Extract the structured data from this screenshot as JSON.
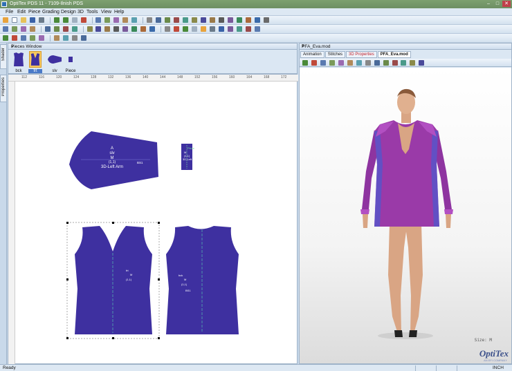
{
  "window": {
    "title": "OptiTex PDS 11 - 7109-Ilnish PDS",
    "min": "–",
    "max": "□",
    "close": "✕"
  },
  "menu": [
    "File",
    "Edit",
    "Piece",
    "Grading",
    "Design",
    "3D",
    "Tools",
    "View",
    "Help"
  ],
  "side_tabs": [
    "Shader",
    "Properties"
  ],
  "pieces_window": {
    "title": "Pieces Window",
    "pin": "↓",
    "close": "×",
    "pieces": [
      {
        "name": "bck",
        "selected": false
      },
      {
        "name": "frt",
        "selected": true
      },
      {
        "name": "slv",
        "selected": false
      },
      {
        "name": "Piece",
        "selected": false
      }
    ]
  },
  "ruler": {
    "ticks": [
      "112",
      "116",
      "120",
      "124",
      "128",
      "132",
      "136",
      "140",
      "144",
      "148",
      "152",
      "156",
      "160",
      "164",
      "168",
      "172"
    ]
  },
  "pattern": {
    "piece_color": "#3e30a0",
    "sleeve": {
      "lines": [
        "A",
        "slv",
        "M",
        "(1,1)",
        "3D-Left Arm"
      ],
      "tag": "BS1"
    },
    "small_piece": {
      "lines": [
        "Piece",
        "M",
        "(1,1)",
        "3D-Left"
      ]
    },
    "front": {
      "lines": [
        "frt",
        "M",
        "(1,1)"
      ]
    },
    "back": {
      "lines": [
        "bck",
        "M",
        "(1,1)"
      ],
      "tag": "BS1"
    }
  },
  "viewer": {
    "title": "PFA_Eva.mod",
    "pin": "↓",
    "close": "×",
    "tabs": [
      "Animation",
      "Stitches",
      "3D Properties",
      "PFA_Eva.mod"
    ],
    "active_tab": "PFA_Eva.mod",
    "size_label": "Size: M",
    "logo": "OptiTex",
    "logo_sub": "AN EFI COMPANY",
    "garment_color": "#9a3aa8"
  },
  "status": {
    "left": "Ready",
    "units": "INCH"
  },
  "colors": {
    "accent": "#2f6fb3",
    "panel": "#dbe7f3",
    "frame": "#c9d9ea"
  }
}
